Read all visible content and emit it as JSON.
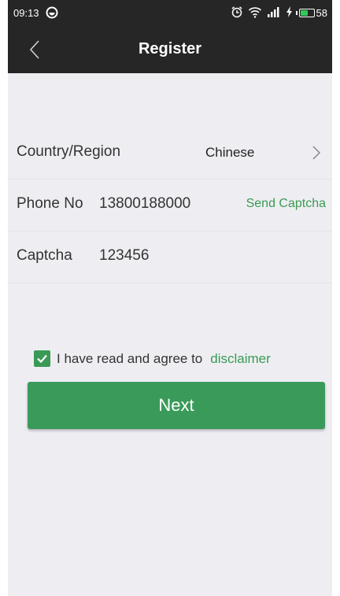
{
  "status_bar": {
    "time": "09:13",
    "battery_level": "58",
    "battery_fill_fraction": 0.58,
    "icons": [
      "sync-icon",
      "alarm-icon",
      "wifi-icon",
      "signal-icon",
      "charging-icon",
      "battery-icon"
    ]
  },
  "header": {
    "title": "Register",
    "back_icon": "chevron-left-icon"
  },
  "form": {
    "country": {
      "label": "Country/Region",
      "value": "Chinese",
      "icon": "chevron-right-icon"
    },
    "phone": {
      "label": "Phone No",
      "value": "13800188000",
      "action": "Send Captcha"
    },
    "captcha": {
      "label": "Captcha",
      "value": "123456"
    }
  },
  "agreement": {
    "checked": true,
    "text": "I have read and agree to",
    "link": "disclaimer"
  },
  "actions": {
    "next_label": "Next"
  },
  "colors": {
    "accent": "#3a9a55",
    "header_bg": "#262626",
    "page_bg": "#eeeef2",
    "battery": "#34c85a"
  }
}
